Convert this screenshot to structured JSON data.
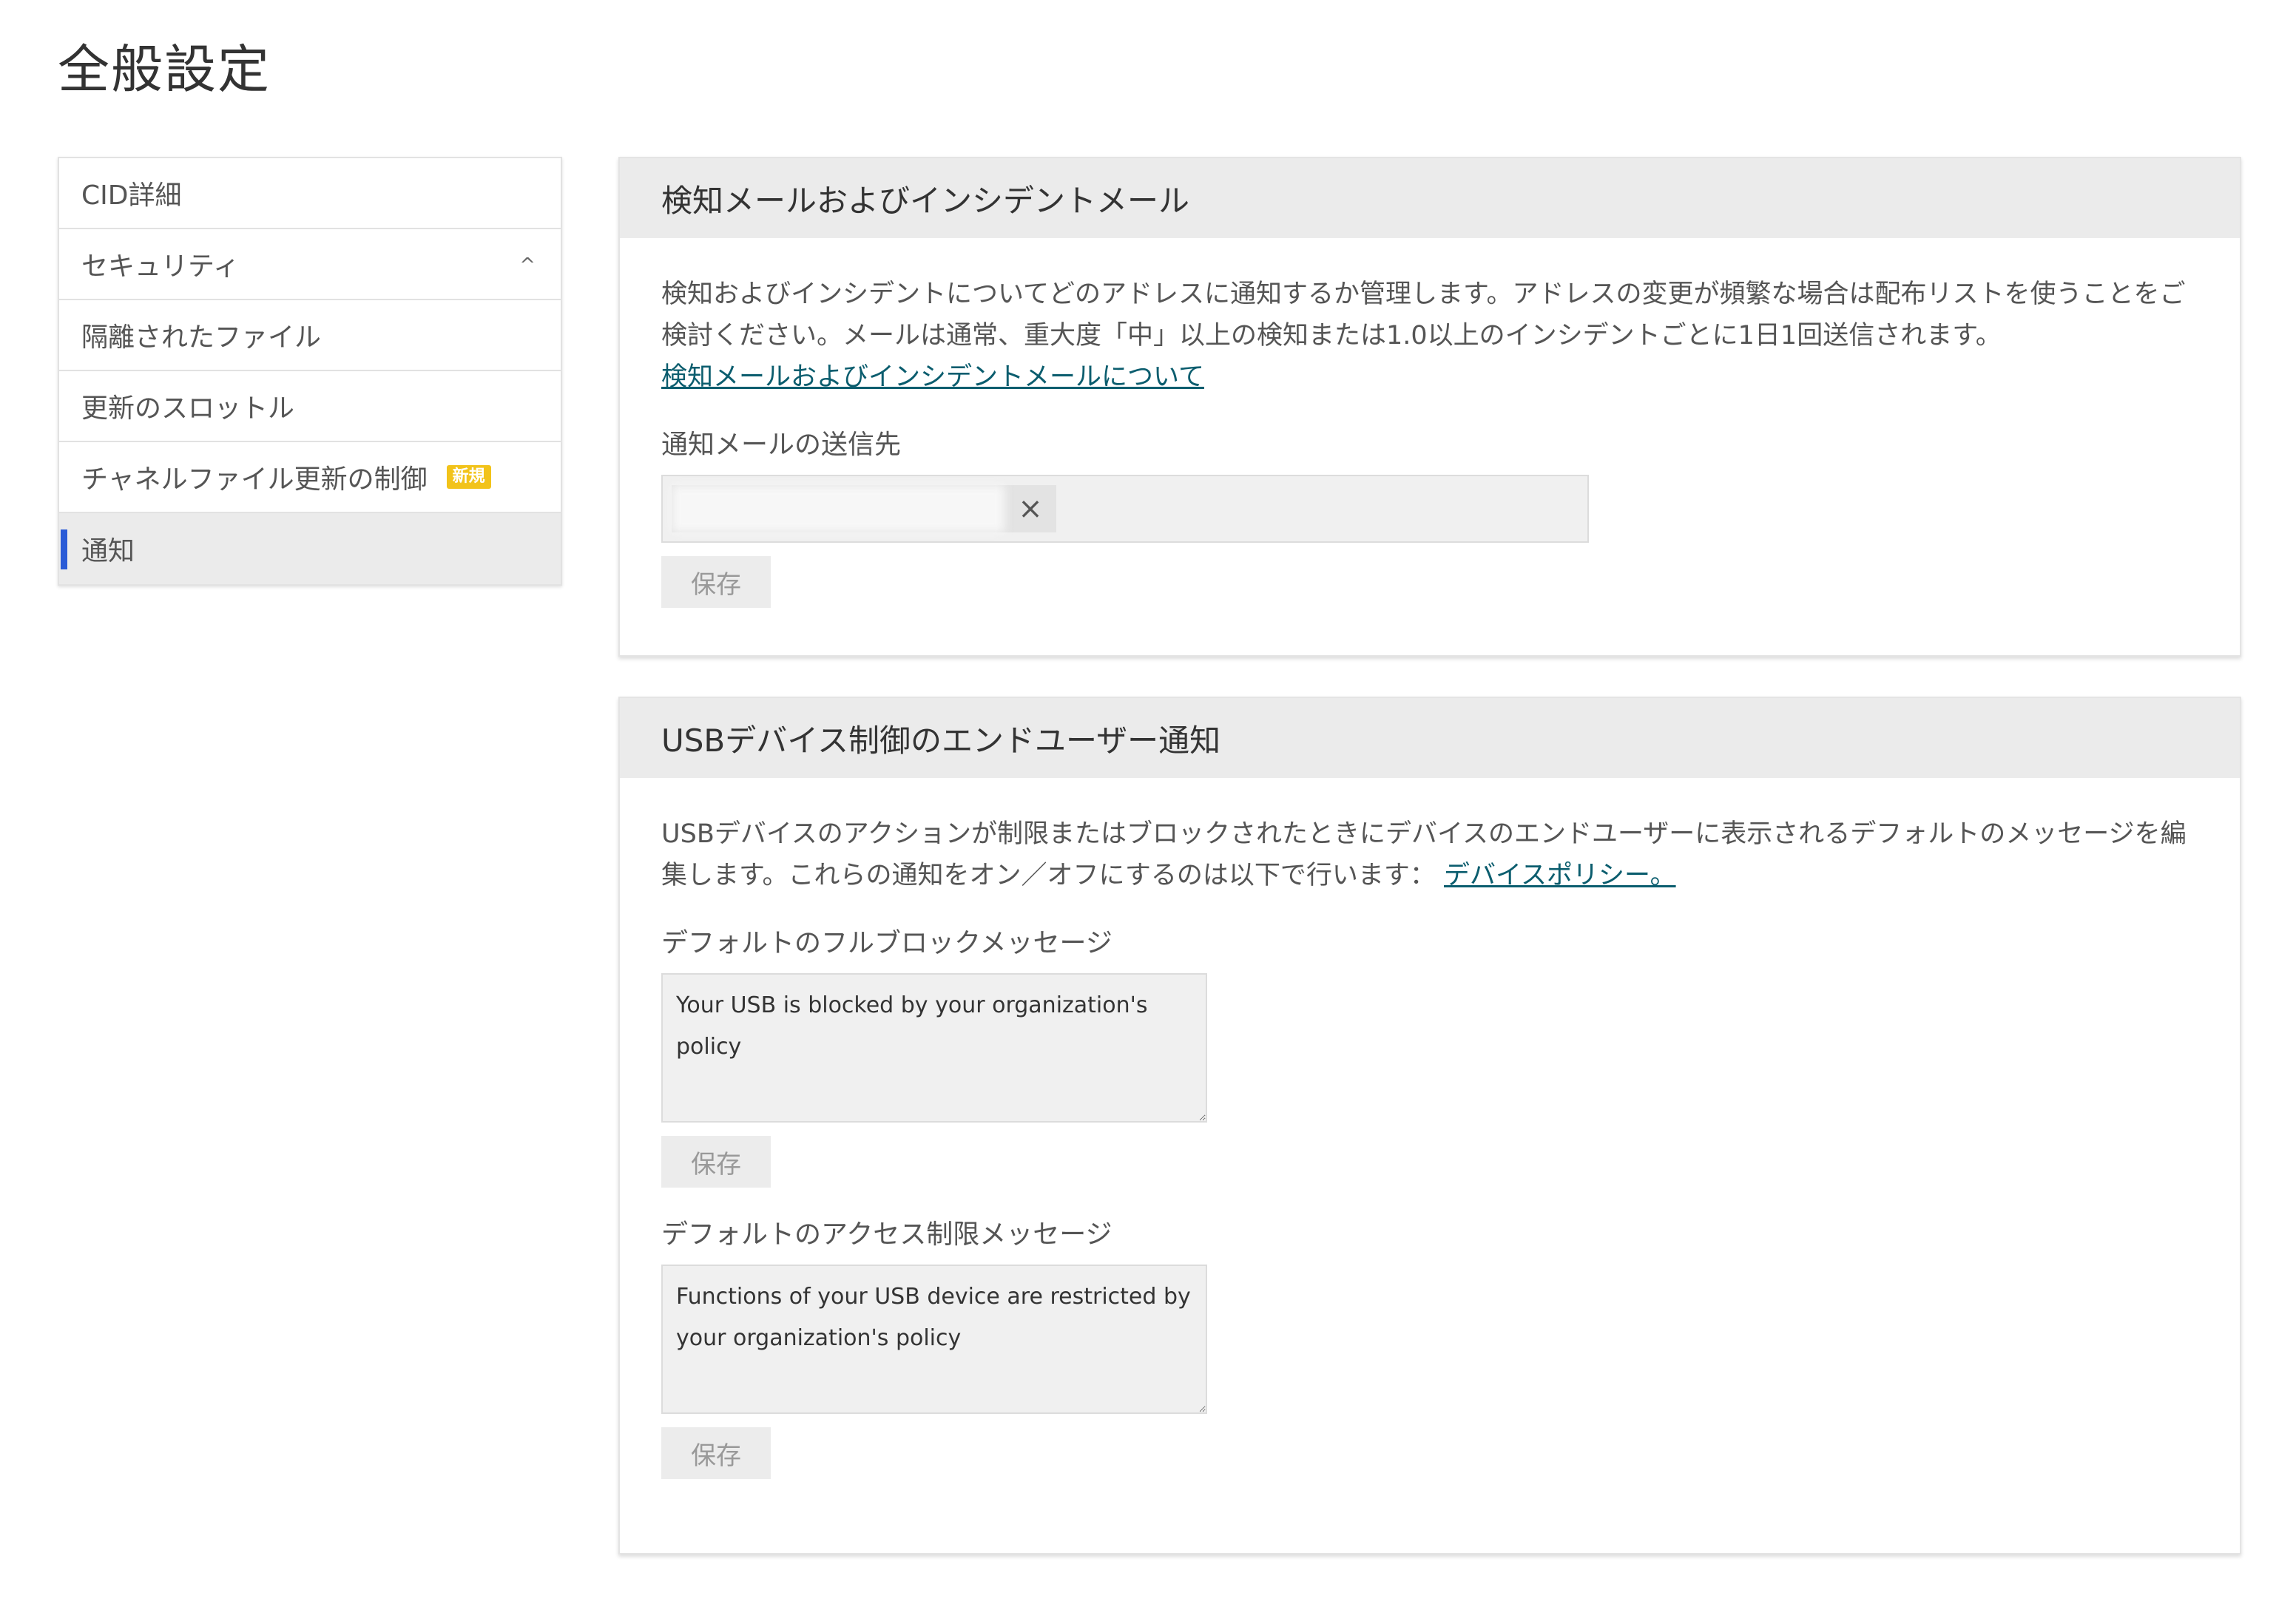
{
  "page": {
    "title": "全般設定"
  },
  "sidebar": {
    "items": [
      {
        "label": "CID詳細"
      },
      {
        "label": "セキュリティ",
        "chevron": "^"
      },
      {
        "label": "隔離されたファイル"
      },
      {
        "label": "更新のスロットル"
      },
      {
        "label": "チャネルファイル更新の制御",
        "badge": "新規"
      },
      {
        "label": "通知",
        "active": true
      }
    ]
  },
  "detection_panel": {
    "title": "検知メールおよびインシデントメール",
    "description": "検知およびインシデントについてどのアドレスに通知するか管理します。アドレスの変更が頻繁な場合は配布リストを使うことをご検討ください。メールは通常、重大度「中」以上の検知または1.0以上のインシデントごとに1日1回送信されます。",
    "link": "検知メールおよびインシデントメールについて",
    "recipients_label": "通知メールの送信先",
    "chip_close": "×",
    "save_label": "保存"
  },
  "usb_panel": {
    "title": "USBデバイス制御のエンドユーザー通知",
    "description": "USBデバイスのアクションが制限またはブロックされたときにデバイスのエンドユーザーに表示されるデフォルトのメッセージを編集します。これらの通知をオン／オフにするのは以下で行います：",
    "link": "デバイスポリシー。",
    "block_label": "デフォルトのフルブロックメッセージ",
    "block_message": "Your USB is blocked by your organization's policy",
    "block_save_label": "保存",
    "restrict_label": "デフォルトのアクセス制限メッセージ",
    "restrict_message": "Functions of your USB device are restricted by your organization's policy",
    "restrict_save_label": "保存"
  }
}
